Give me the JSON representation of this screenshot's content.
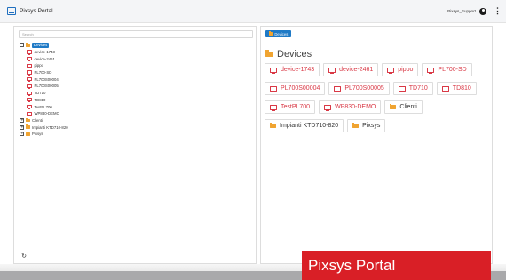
{
  "app": {
    "title": "Pixsys Portal",
    "user": "Pixsys_Support"
  },
  "icons": {
    "logo": "monitor-logo-icon",
    "user": "user-circle-icon",
    "menu": "more-vertical-icon",
    "refresh": "refresh-icon",
    "device": "monitor-icon",
    "folder": "folder-icon"
  },
  "colors": {
    "accent": "#1f7ac6",
    "device": "#d93845",
    "folder": "#f0a431",
    "banner": "#d91f26"
  },
  "left": {
    "search_placeholder": "Search",
    "tree": {
      "root": {
        "label": "Devices",
        "expander": "−"
      },
      "devices": [
        "device-1743",
        "device-2461",
        "pippo",
        "PL700-SD",
        "PL700S00004",
        "PL700S00005",
        "TD710",
        "TD810",
        "TestPL700",
        "WP830-DEMO"
      ],
      "folders": [
        {
          "label": "Clienti",
          "expander": "+"
        },
        {
          "label": "Impianti KTD710-820",
          "expander": "+"
        },
        {
          "label": "Pixsys",
          "expander": "+"
        }
      ]
    },
    "refresh_glyph": "↻"
  },
  "right": {
    "breadcrumb": "Devices",
    "heading": "Devices",
    "cards": [
      {
        "label": "device-1743",
        "kind": "device"
      },
      {
        "label": "device-2461",
        "kind": "device"
      },
      {
        "label": "pippo",
        "kind": "device"
      },
      {
        "label": "PL700-SD",
        "kind": "device"
      },
      {
        "label": "PL700S00004",
        "kind": "device"
      },
      {
        "label": "PL700S00005",
        "kind": "device"
      },
      {
        "label": "TD710",
        "kind": "device"
      },
      {
        "label": "TD810",
        "kind": "device"
      },
      {
        "label": "TestPL700",
        "kind": "device"
      },
      {
        "label": "WP830-DEMO",
        "kind": "device"
      },
      {
        "label": "Clienti",
        "kind": "folder"
      },
      {
        "label": "Impianti KTD710-820",
        "kind": "folder"
      },
      {
        "label": "Pixsys",
        "kind": "folder"
      }
    ]
  },
  "banner": {
    "text": "Pixsys Portal"
  }
}
